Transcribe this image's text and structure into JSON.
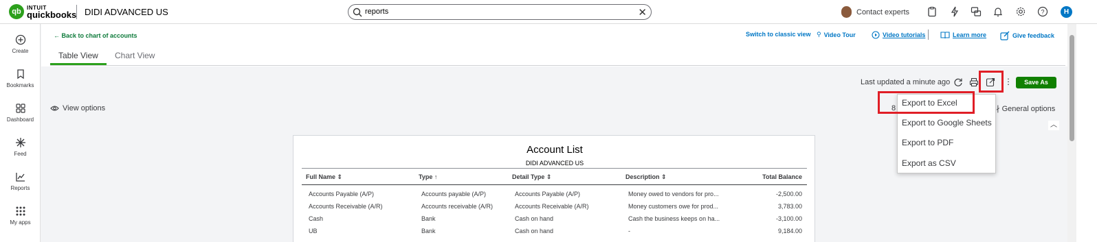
{
  "brand": {
    "small": "INTUIT",
    "big": "quickbooks",
    "company": "DIDI ADVANCED US"
  },
  "search": {
    "value": "reports"
  },
  "header": {
    "contact_experts": "Contact experts",
    "user_initial": "H"
  },
  "nav": [
    {
      "label": "Create",
      "icon": "plus-circle-icon"
    },
    {
      "label": "Bookmarks",
      "icon": "bookmark-icon"
    },
    {
      "label": "Dashboard",
      "icon": "dashboard-icon"
    },
    {
      "label": "Feed",
      "icon": "feed-icon"
    },
    {
      "label": "Reports",
      "icon": "reports-icon"
    },
    {
      "label": "My apps",
      "icon": "apps-icon"
    }
  ],
  "page": {
    "back_link": "Back to chart of accounts",
    "tabs": [
      "Table View",
      "Chart View"
    ],
    "links": {
      "classic": "Switch to classic view",
      "video_tour": "Video Tour",
      "video_tutorials": "Video tutorials",
      "learn_more": "Learn more",
      "feedback": "Give feedback"
    },
    "last_updated": "Last updated a minute ago",
    "save_as": "Save As",
    "view_options": "View options",
    "general_options": "General options"
  },
  "export_menu": [
    "Export to Excel",
    "Export to Google Sheets",
    "Export to PDF",
    "Export as CSV"
  ],
  "report": {
    "title": "Account List",
    "subtitle": "DIDI ADVANCED US",
    "columns": [
      "Full Name",
      "Type",
      "Detail Type",
      "Description",
      "Total Balance"
    ],
    "rows": [
      [
        "Accounts Payable (A/P)",
        "Accounts payable (A/P)",
        "Accounts Payable (A/P)",
        "Money owed to vendors for pro...",
        "-2,500.00"
      ],
      [
        "Accounts Receivable (A/R)",
        "Accounts receivable (A/R)",
        "Accounts Receivable (A/R)",
        "Money customers owe for prod...",
        "3,783.00"
      ],
      [
        "Cash",
        "Bank",
        "Cash on hand",
        "Cash the business keeps on ha...",
        "-3,100.00"
      ],
      [
        "UB",
        "Bank",
        "Cash on hand",
        "-",
        "9,184.00"
      ]
    ]
  },
  "colors": {
    "brand_green": "#2ca01c",
    "save_green": "#108000",
    "link_blue": "#0077c5",
    "highlight_red": "#e01e26"
  }
}
